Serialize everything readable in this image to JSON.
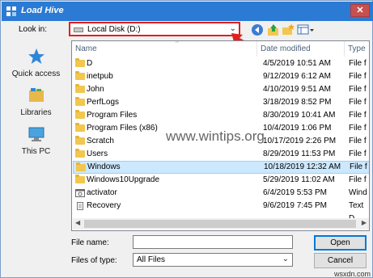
{
  "window": {
    "title": "Load Hive",
    "close_glyph": "✕"
  },
  "toolbar": {
    "look_in_label": "Look in:",
    "look_in_value": "Local Disk (D:)",
    "icons": [
      "back-icon",
      "up-folder-icon",
      "new-folder-icon",
      "view-menu-icon"
    ]
  },
  "places": [
    {
      "label": "Quick access",
      "icon": "quick-access-star-icon"
    },
    {
      "label": "Libraries",
      "icon": "libraries-icon"
    },
    {
      "label": "This PC",
      "icon": "this-pc-icon"
    }
  ],
  "file_list": {
    "headers": {
      "name": "Name",
      "date": "Date modified",
      "type": "Type"
    },
    "rows": [
      {
        "name": "D",
        "date": "4/5/2019 10:51 AM",
        "type": "File f",
        "icon": "folder",
        "selected": false
      },
      {
        "name": "inetpub",
        "date": "9/12/2019 6:12 AM",
        "type": "File f",
        "icon": "folder",
        "selected": false
      },
      {
        "name": "John",
        "date": "4/10/2019 9:51 AM",
        "type": "File f",
        "icon": "folder",
        "selected": false
      },
      {
        "name": "PerfLogs",
        "date": "3/18/2019 8:52 PM",
        "type": "File f",
        "icon": "folder",
        "selected": false
      },
      {
        "name": "Program Files",
        "date": "8/30/2019 10:41 AM",
        "type": "File f",
        "icon": "folder",
        "selected": false
      },
      {
        "name": "Program Files (x86)",
        "date": "10/4/2019 1:06 PM",
        "type": "File f",
        "icon": "folder",
        "selected": false
      },
      {
        "name": "Scratch",
        "date": "10/17/2019 2:26 PM",
        "type": "File f",
        "icon": "folder",
        "selected": false
      },
      {
        "name": "Users",
        "date": "8/29/2019 11:53 PM",
        "type": "File f",
        "icon": "folder",
        "selected": false
      },
      {
        "name": "Windows",
        "date": "10/18/2019 12:32 AM",
        "type": "File f",
        "icon": "folder",
        "selected": true
      },
      {
        "name": "Windows10Upgrade",
        "date": "5/29/2019 11:02 AM",
        "type": "File f",
        "icon": "folder",
        "selected": false
      },
      {
        "name": "activator",
        "date": "6/4/2019 5:53 PM",
        "type": "Wind",
        "icon": "file",
        "selected": false
      },
      {
        "name": "Recovery",
        "date": "9/6/2019 7:45 PM",
        "type": "Text D",
        "icon": "file",
        "selected": false
      }
    ]
  },
  "bottom": {
    "file_name_label": "File name:",
    "file_name_value": "",
    "files_of_type_label": "Files of type:",
    "files_of_type_value": "All Files",
    "open_label": "Open",
    "cancel_label": "Cancel"
  },
  "watermarks": {
    "center": "www.wintips.org",
    "corner": "wsxdn.com"
  },
  "colors": {
    "titlebar": "#2b7ad4",
    "highlight_border": "#e02020",
    "selection": "#cce8ff",
    "folder": "#f1c74f"
  }
}
